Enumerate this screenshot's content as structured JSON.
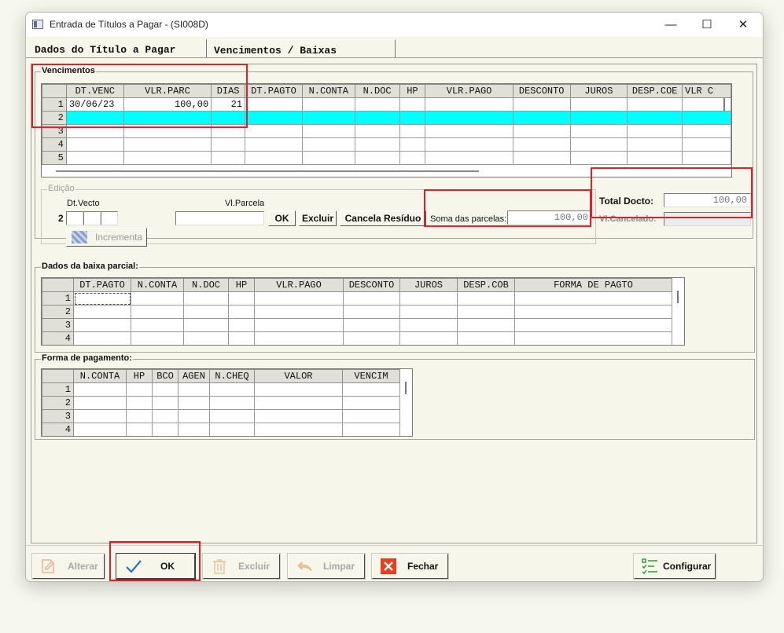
{
  "window": {
    "title": "Entrada de Títulos a Pagar - (SI008D)",
    "minimize": "—",
    "maximize": "☐",
    "close": "✕"
  },
  "tabs": [
    {
      "label": "Dados do Título a Pagar"
    },
    {
      "label": "Vencimentos / Baixas"
    }
  ],
  "vencimentos": {
    "group_label": "Vencimentos",
    "columns": [
      "DT.VENC",
      "VLR.PARC",
      "DIAS",
      "DT.PAGTO",
      "N.CONTA",
      "N.DOC",
      "HP",
      "VLR.PAGO",
      "DESCONTO",
      "JUROS",
      "DESP.COE",
      "VLR C"
    ],
    "rows": [
      {
        "n": "1",
        "dt_venc": "30/06/23",
        "vlr_parc": "100,00",
        "dias": "21"
      },
      {
        "n": "2",
        "dt_venc": "",
        "vlr_parc": "",
        "dias": ""
      },
      {
        "n": "3",
        "dt_venc": "",
        "vlr_parc": "",
        "dias": ""
      },
      {
        "n": "4",
        "dt_venc": "",
        "vlr_parc": "",
        "dias": ""
      },
      {
        "n": "5",
        "dt_venc": "",
        "vlr_parc": "",
        "dias": ""
      }
    ]
  },
  "edicao": {
    "group_label": "Edição",
    "dt_vecto_label": "Dt.Vecto",
    "vl_parcela_label": "Vl.Parcela",
    "row_num": "2",
    "ok_label": "OK",
    "excluir_label": "Excluir",
    "cancela_label": "Cancela Resíduo",
    "incrementa_label": "Incrementa",
    "soma_label": "Soma das parcelas:",
    "soma_value": "100,00"
  },
  "totals": {
    "total_docto_label": "Total Docto:",
    "total_docto_value": "100,00",
    "vl_cancelado_label": "Vl.Cancelado:",
    "vl_cancelado_value": ""
  },
  "baixa_parcial": {
    "group_label": "Dados da baixa parcial:",
    "columns": [
      "DT.PAGTO",
      "N.CONTA",
      "N.DOC",
      "HP",
      "VLR.PAGO",
      "DESCONTO",
      "JUROS",
      "DESP.COB",
      "FORMA DE PAGTO"
    ],
    "rows": [
      "1",
      "2",
      "3",
      "4"
    ]
  },
  "forma_pagamento": {
    "group_label": "Forma de pagamento:",
    "columns": [
      "N.CONTA",
      "HP",
      "BCO",
      "AGEN",
      "N.CHEQ",
      "VALOR",
      "VENCIM"
    ],
    "rows": [
      "1",
      "2",
      "3",
      "4"
    ]
  },
  "buttons": {
    "alterar": "Alterar",
    "ok": "OK",
    "excluir": "Excluir",
    "limpar": "Limpar",
    "fechar": "Fechar",
    "configurar": "Configurar"
  },
  "colors": {
    "highlight_row": "#00ffff",
    "annotation_red": "#e0202a",
    "ok_check": "#2a6fd6",
    "close_red": "#e8401c",
    "configure_green": "#2a9a3a"
  }
}
